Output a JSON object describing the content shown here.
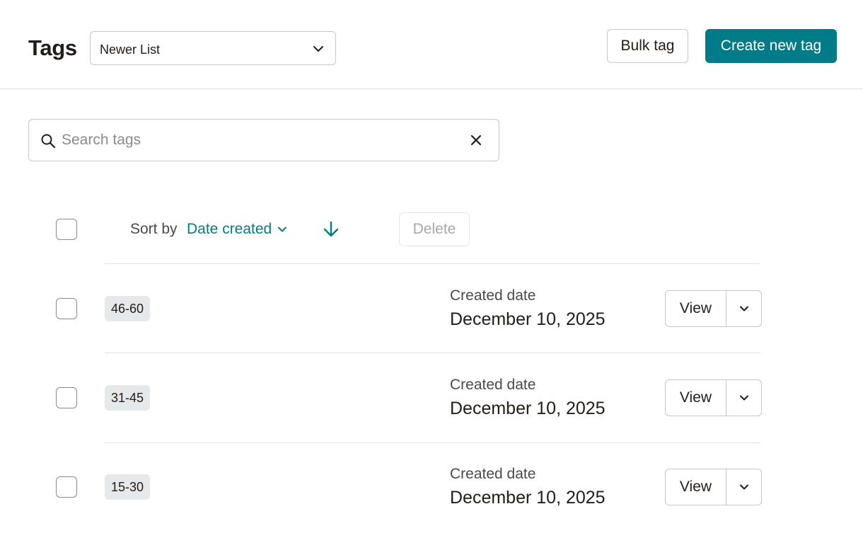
{
  "header": {
    "title": "Tags",
    "list_select": {
      "value": "Newer List"
    },
    "bulk_tag_label": "Bulk tag",
    "create_tag_label": "Create new tag"
  },
  "search": {
    "placeholder": "Search tags",
    "value": ""
  },
  "toolbar": {
    "sort_label": "Sort by",
    "sort_value": "Date created",
    "sort_direction": "descending",
    "delete_label": "Delete"
  },
  "rows": [
    {
      "tag": "46-60",
      "date_label": "Created date",
      "date": "December 10, 2025",
      "view_label": "View"
    },
    {
      "tag": "31-45",
      "date_label": "Created date",
      "date": "December 10, 2025",
      "view_label": "View"
    },
    {
      "tag": "15-30",
      "date_label": "Created date",
      "date": "December 10, 2025",
      "view_label": "View"
    }
  ],
  "colors": {
    "accent": "#007c89",
    "text": "#241c15",
    "badge_bg": "#e6e9eb"
  }
}
